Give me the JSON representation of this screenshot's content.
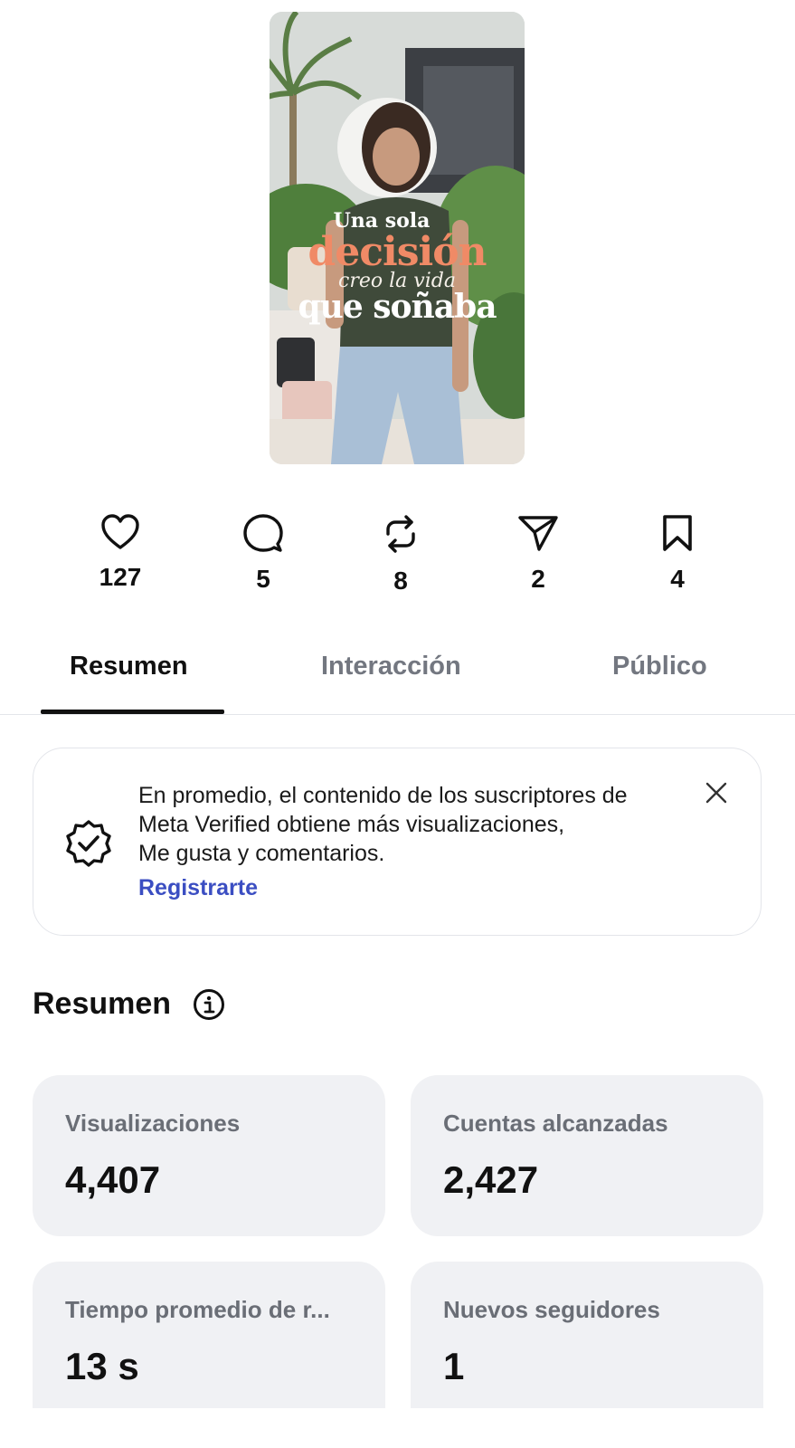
{
  "post": {
    "overlay_text": {
      "line1": "Una sola",
      "line2": "decisión",
      "line3": "creo la vida",
      "line4": "que soñaba"
    }
  },
  "stats": [
    {
      "icon": "heart-icon",
      "value": "127"
    },
    {
      "icon": "comment-icon",
      "value": "5"
    },
    {
      "icon": "repost-icon",
      "value": "8"
    },
    {
      "icon": "share-icon",
      "value": "2"
    },
    {
      "icon": "bookmark-icon",
      "value": "4"
    }
  ],
  "tabs": [
    {
      "label": "Resumen",
      "active": true
    },
    {
      "label": "Interacción",
      "active": false
    },
    {
      "label": "Público",
      "active": false
    }
  ],
  "banner": {
    "icon": "verified-badge-icon",
    "line1": "En promedio, el contenido de los suscriptores de",
    "line2": "Meta Verified obtiene más visualizaciones,",
    "line3": "Me gusta y comentarios.",
    "link": "Registrarte",
    "close_icon": "close-icon"
  },
  "summary": {
    "title": "Resumen",
    "info_icon": "info-icon",
    "metrics": [
      {
        "label": "Visualizaciones",
        "value": "4,407"
      },
      {
        "label": "Cuentas alcanzadas",
        "value": "2,427"
      },
      {
        "label": "Tiempo promedio de r...",
        "value": "13 s"
      },
      {
        "label": "Nuevos seguidores",
        "value": "1"
      }
    ]
  },
  "colors": {
    "accent_link": "#3b4ec2",
    "card_bg": "#f0f1f4",
    "text_primary": "#111111",
    "text_secondary": "#737780"
  }
}
